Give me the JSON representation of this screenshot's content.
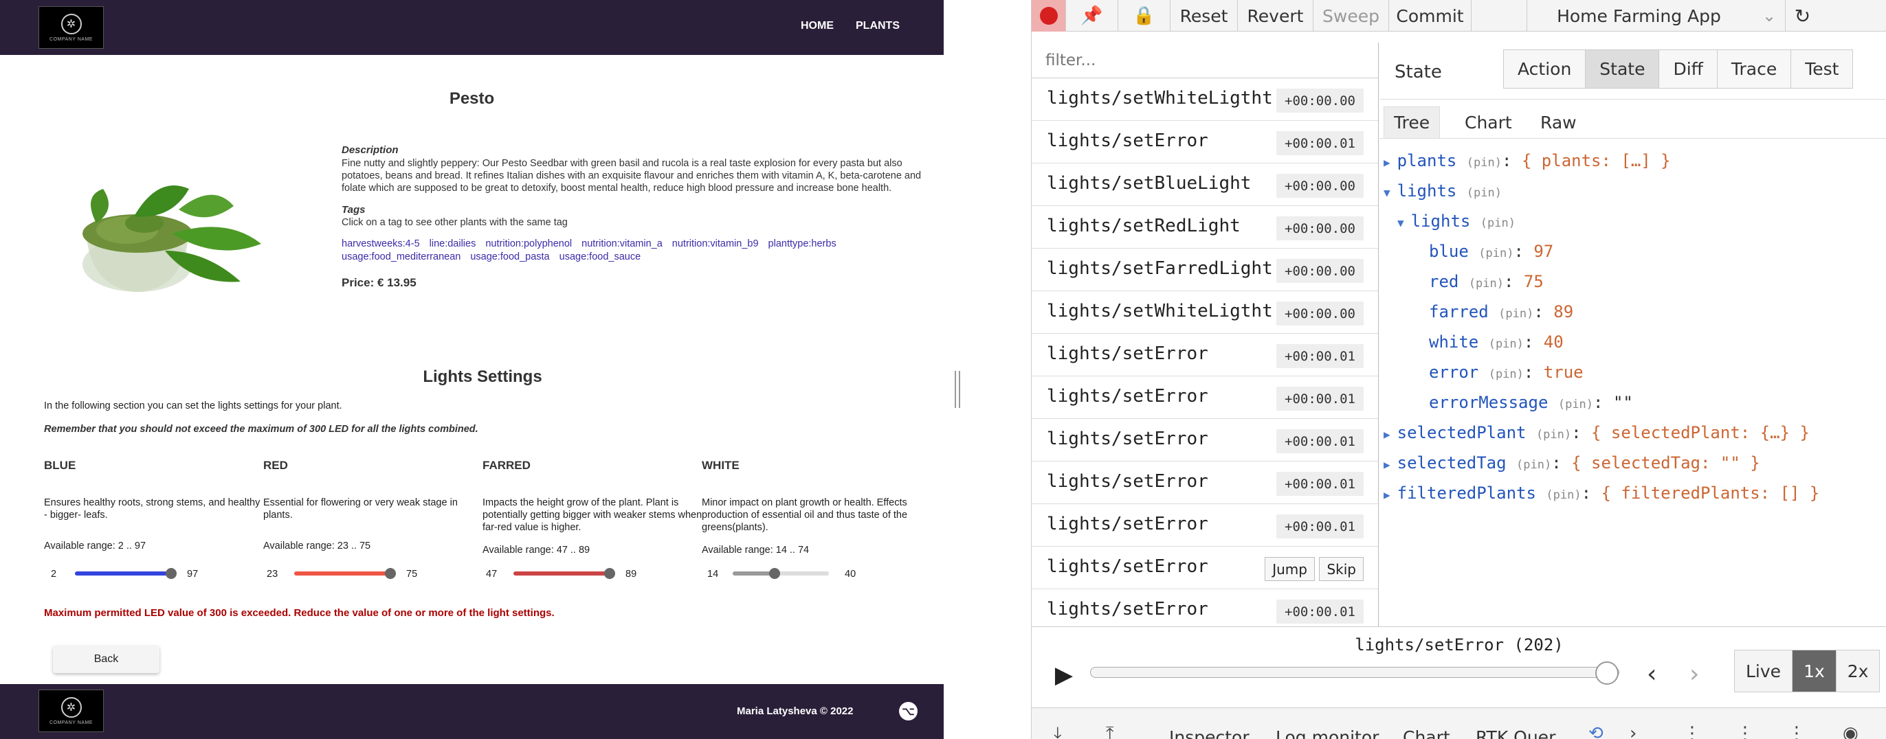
{
  "app": {
    "logo_text": "COMPANY NAME",
    "nav": {
      "home": "HOME",
      "plants": "PLANTS"
    },
    "title": "Pesto",
    "description_heading": "Description",
    "description": "Fine nutty and slightly peppery: Our Pesto Seedbar with green basil and rucola is a real taste explosion for every pasta but also potatoes, beans and bread. It refines Italian dishes with an exquisite flavour and enriches them with vitamin A, K, beta-carotene and folate which are supposed to be great to detoxify, boost mental health, reduce high blood pressure and increase bone health.",
    "tags_heading": "Tags",
    "tags_subtitle": "Click on a tag to see other plants with the same tag",
    "tags": [
      "harvestweeks:4-5",
      "line:dailies",
      "nutrition:polyphenol",
      "nutrition:vitamin_a",
      "nutrition:vitamin_b9",
      "planttype:herbs",
      "usage:food_mediterranean",
      "usage:food_pasta",
      "usage:food_sauce"
    ],
    "price": "Price: € 13.95",
    "lights_title": "Lights Settings",
    "lights_intro": "In the following section you can set the lights settings for your plant.",
    "lights_warning": "Remember that you should not exceed the maximum of 300 LED for all the lights combined.",
    "lights": [
      {
        "name": "BLUE",
        "desc": "Ensures healthy roots, strong stems, and healthy - bigger- leafs.",
        "range": "Available range: 2 .. 97",
        "min": "2",
        "max": "97",
        "min_val": 2,
        "max_val": 97,
        "value": 97,
        "color": "#3344dd"
      },
      {
        "name": "RED",
        "desc": "Essential for flowering or very weak stage in plants.",
        "range": "Available range: 23 .. 75",
        "min": "23",
        "max": "75",
        "min_val": 23,
        "max_val": 75,
        "value": 75,
        "color": "#ee5544"
      },
      {
        "name": "FARRED",
        "desc": "Impacts the height grow of the plant. Plant is potentially getting bigger with weaker stems when far-red value is higher.",
        "range": "Available range: 47 .. 89",
        "min": "47",
        "max": "89",
        "min_val": 47,
        "max_val": 89,
        "value": 89,
        "color": "#cc4444"
      },
      {
        "name": "WHITE",
        "desc": "Minor impact on plant growth or health. Effects production of essential oil and thus taste of the greens(plants).",
        "range": "Available range: 14 .. 74",
        "min": "14",
        "max": "40",
        "min_val": 14,
        "max_val": 74,
        "value": 40,
        "color": "#999999"
      }
    ],
    "error_message": "Maximum permitted LED value of 300 is exceeded. Reduce the value of one or more of the light settings.",
    "back_label": "Back",
    "footer_copy": "Maria Latysheva © 2022"
  },
  "devtools": {
    "toolbar": {
      "reset": "Reset",
      "revert": "Revert",
      "sweep": "Sweep",
      "commit": "Commit",
      "app_name": "Home Farming App"
    },
    "filter_placeholder": "filter...",
    "actions": [
      {
        "name": "lights/setWhiteLigtht",
        "time": "+00:00.00"
      },
      {
        "name": "lights/setError",
        "time": "+00:00.01"
      },
      {
        "name": "lights/setBlueLight",
        "time": "+00:00.00"
      },
      {
        "name": "lights/setRedLight",
        "time": "+00:00.00"
      },
      {
        "name": "lights/setFarredLight",
        "time": "+00:00.00"
      },
      {
        "name": "lights/setWhiteLigtht",
        "time": "+00:00.00"
      },
      {
        "name": "lights/setError",
        "time": "+00:00.01"
      },
      {
        "name": "lights/setError",
        "time": "+00:00.01"
      },
      {
        "name": "lights/setError",
        "time": "+00:00.01"
      },
      {
        "name": "lights/setError",
        "time": "+00:00.01"
      },
      {
        "name": "lights/setError",
        "time": "+00:00.01"
      },
      {
        "name": "lights/setError",
        "time": "",
        "hovered": true
      },
      {
        "name": "lights/setError",
        "time": "+00:00.01"
      }
    ],
    "row_jump": "Jump",
    "row_skip": "Skip",
    "inspector_label": "State",
    "mode_tabs": [
      "Action",
      "State",
      "Diff",
      "Trace",
      "Test"
    ],
    "active_mode": "State",
    "view_tabs": [
      "Tree",
      "Chart",
      "Raw"
    ],
    "active_view": "Tree",
    "pin_label": "(pin)",
    "tree": {
      "plants": {
        "key": "plants",
        "summary": "{ plants: […] }"
      },
      "lights": {
        "key": "lights"
      },
      "lights_inner": {
        "key": "lights"
      },
      "blue": {
        "key": "blue",
        "value": "97"
      },
      "red": {
        "key": "red",
        "value": "75"
      },
      "farred": {
        "key": "farred",
        "value": "89"
      },
      "white": {
        "key": "white",
        "value": "40"
      },
      "error": {
        "key": "error",
        "value": "true"
      },
      "errorMessage": {
        "key": "errorMessage",
        "value": "\"\""
      },
      "selectedPlant": {
        "key": "selectedPlant",
        "summary": "{ selectedPlant: {…} }"
      },
      "selectedTag": {
        "key": "selectedTag",
        "summary": "{ selectedTag: \"\" }"
      },
      "filteredPlants": {
        "key": "filteredPlants",
        "summary": "{ filteredPlants: [] }"
      }
    },
    "current_action": "lights/setError (202)",
    "timeline_position": 1.0,
    "speed": {
      "live": "Live",
      "x1": "1x",
      "x2": "2x"
    },
    "bottom_tabs": [
      "Inspector",
      "Log monitor",
      "Chart",
      "RTK Quer"
    ]
  }
}
